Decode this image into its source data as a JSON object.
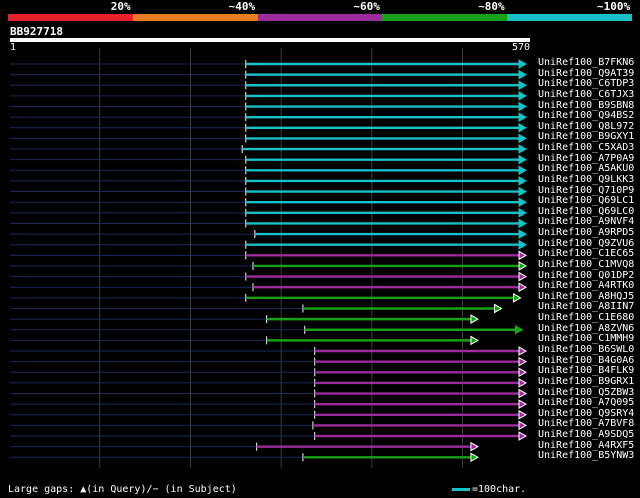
{
  "identity_scale": [
    {
      "label": "20%",
      "color": "#e8202c"
    },
    {
      "label": "~40%",
      "color": "#e87c20"
    },
    {
      "label": "~60%",
      "color": "#9c2c9c"
    },
    {
      "label": "~80%",
      "color": "#18a018"
    },
    {
      "label": "~100%",
      "color": "#18c0c8"
    }
  ],
  "query": {
    "id": "BB927718",
    "start": "1",
    "end": "570",
    "length": 570
  },
  "hits": [
    {
      "id": "UniRef100_B7FKN6",
      "start": 261,
      "end": 570,
      "identity": "100",
      "tail": "arrow"
    },
    {
      "id": "UniRef100_Q9AT39",
      "start": 261,
      "end": 570,
      "identity": "100",
      "tail": "arrow"
    },
    {
      "id": "UniRef100_C6TDP3",
      "start": 261,
      "end": 570,
      "identity": "100",
      "tail": "arrow"
    },
    {
      "id": "UniRef100_C6TJX3",
      "start": 261,
      "end": 570,
      "identity": "100",
      "tail": "arrow"
    },
    {
      "id": "UniRef100_B9SBN8",
      "start": 261,
      "end": 570,
      "identity": "100",
      "tail": "arrow"
    },
    {
      "id": "UniRef100_Q94BS2",
      "start": 261,
      "end": 570,
      "identity": "100",
      "tail": "arrow"
    },
    {
      "id": "UniRef100_Q8L972",
      "start": 261,
      "end": 570,
      "identity": "100",
      "tail": "arrow"
    },
    {
      "id": "UniRef100_B9GXY1",
      "start": 261,
      "end": 570,
      "identity": "100",
      "tail": "arrow"
    },
    {
      "id": "UniRef100_C5XAD3",
      "start": 257,
      "end": 570,
      "identity": "100",
      "tail": "arrow"
    },
    {
      "id": "UniRef100_A7P0A9",
      "start": 261,
      "end": 570,
      "identity": "100",
      "tail": "arrow"
    },
    {
      "id": "UniRef100_A5AKU0",
      "start": 261,
      "end": 570,
      "identity": "100",
      "tail": "arrow"
    },
    {
      "id": "UniRef100_Q9LKK3",
      "start": 261,
      "end": 570,
      "identity": "100",
      "tail": "arrow"
    },
    {
      "id": "UniRef100_Q710P9",
      "start": 261,
      "end": 570,
      "identity": "100",
      "tail": "arrow"
    },
    {
      "id": "UniRef100_Q69LC1",
      "start": 261,
      "end": 570,
      "identity": "100",
      "tail": "arrow"
    },
    {
      "id": "UniRef100_Q69LC0",
      "start": 261,
      "end": 570,
      "identity": "100",
      "tail": "arrow"
    },
    {
      "id": "UniRef100_A9NVF4",
      "start": 261,
      "end": 570,
      "identity": "100",
      "tail": "arrow"
    },
    {
      "id": "UniRef100_A9RPD5",
      "start": 271,
      "end": 570,
      "identity": "100",
      "tail": "arrow"
    },
    {
      "id": "UniRef100_Q9ZVU6",
      "start": 261,
      "end": 570,
      "identity": "100",
      "tail": "arrow"
    },
    {
      "id": "UniRef100_C1EC65",
      "start": 261,
      "end": 570,
      "identity": "60",
      "tail": "hollow"
    },
    {
      "id": "UniRef100_C1MVQ8",
      "start": 269,
      "end": 570,
      "identity": "80",
      "tail": "hollow"
    },
    {
      "id": "UniRef100_Q01DP2",
      "start": 261,
      "end": 570,
      "identity": "60",
      "tail": "hollow"
    },
    {
      "id": "UniRef100_A4RTK0",
      "start": 269,
      "end": 570,
      "identity": "60",
      "tail": "hollow"
    },
    {
      "id": "UniRef100_A8HQJ5",
      "start": 261,
      "end": 564,
      "identity": "80",
      "tail": "hollow"
    },
    {
      "id": "UniRef100_A8IIN7",
      "start": 324,
      "end": 543,
      "identity": "80",
      "tail": "hollow"
    },
    {
      "id": "UniRef100_C1E680",
      "start": 284,
      "end": 517,
      "identity": "80",
      "tail": "hollow"
    },
    {
      "id": "UniRef100_A8ZVN6",
      "start": 326,
      "end": 566,
      "identity": "80",
      "tail": "arrow"
    },
    {
      "id": "UniRef100_C1MMH9",
      "start": 284,
      "end": 517,
      "identity": "80",
      "tail": "hollow"
    },
    {
      "id": "UniRef100_B6SWL0",
      "start": 337,
      "end": 570,
      "identity": "60",
      "tail": "hollow"
    },
    {
      "id": "UniRef100_B4G0A6",
      "start": 337,
      "end": 570,
      "identity": "60",
      "tail": "hollow"
    },
    {
      "id": "UniRef100_B4FLK9",
      "start": 337,
      "end": 570,
      "identity": "60",
      "tail": "hollow"
    },
    {
      "id": "UniRef100_B9GRX1",
      "start": 337,
      "end": 570,
      "identity": "60",
      "tail": "hollow"
    },
    {
      "id": "UniRef100_Q5ZBW3",
      "start": 337,
      "end": 570,
      "identity": "60",
      "tail": "hollow"
    },
    {
      "id": "UniRef100_A7Q095",
      "start": 337,
      "end": 570,
      "identity": "60",
      "tail": "hollow"
    },
    {
      "id": "UniRef100_Q9SRY4",
      "start": 337,
      "end": 570,
      "identity": "60",
      "tail": "hollow"
    },
    {
      "id": "UniRef100_A7BVF8",
      "start": 335,
      "end": 570,
      "identity": "60",
      "tail": "hollow"
    },
    {
      "id": "UniRef100_A9SDQ5",
      "start": 337,
      "end": 570,
      "identity": "60",
      "tail": "hollow"
    },
    {
      "id": "UniRef100_A4RXF5",
      "start": 273,
      "end": 517,
      "identity": "60",
      "tail": "hollow"
    },
    {
      "id": "UniRef100_B5YNW3",
      "start": 324,
      "end": 517,
      "identity": "80",
      "tail": "hollow"
    }
  ],
  "footer": {
    "gaps_label": "Large gaps: ",
    "gaps_query": "▲(in Query)/",
    "gaps_subject": "− (in Subject)"
  },
  "legend": {
    "text": "=100char."
  }
}
